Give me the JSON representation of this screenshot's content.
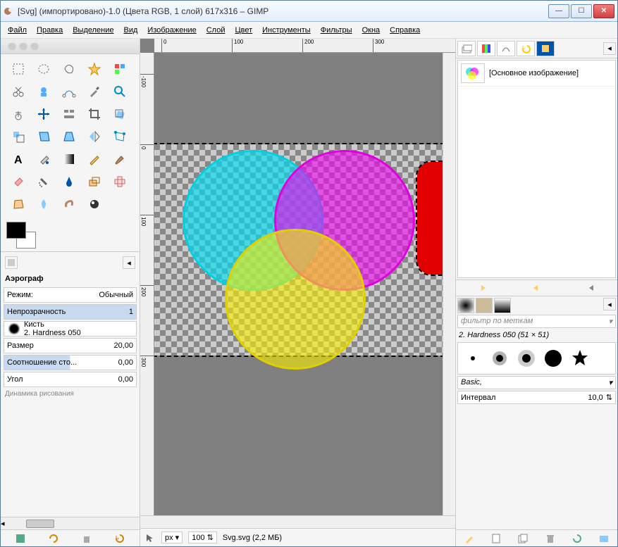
{
  "title": "[Svg] (импортировано)-1.0 (Цвета RGB, 1 слой) 617x316 – GIMP",
  "menu": [
    "Файл",
    "Правка",
    "Выделение",
    "Вид",
    "Изображение",
    "Слой",
    "Цвет",
    "Инструменты",
    "Фильтры",
    "Окна",
    "Справка"
  ],
  "tool_options": {
    "title": "Аэрограф",
    "mode_label": "Режим:",
    "mode_value": "Обычный",
    "opacity_label": "Непрозрачность",
    "opacity_value": "1",
    "brush_label": "Кисть",
    "brush_name": "2. Hardness 050",
    "size_label": "Размер",
    "size_value": "20,00",
    "aspect_label": "Соотношение сто...",
    "aspect_value": "0,00",
    "angle_label": "Угол",
    "angle_value": "0,00",
    "dynamics_label": "Динамика рисования"
  },
  "statusbar": {
    "unit": "px",
    "zoom": "100",
    "filename": "Svg.svg (2,2 МБ)"
  },
  "layer": {
    "name": "[Основное изображение]"
  },
  "brushes": {
    "filter_placeholder": "фильтр по меткам",
    "current": "2. Hardness 050 (51 × 51)",
    "set": "Basic,",
    "interval_label": "Интервал",
    "interval_value": "10,0"
  },
  "ruler_h": [
    "0",
    "100",
    "200",
    "300"
  ],
  "ruler_v": [
    "-100",
    "0",
    "100",
    "200",
    "300"
  ]
}
